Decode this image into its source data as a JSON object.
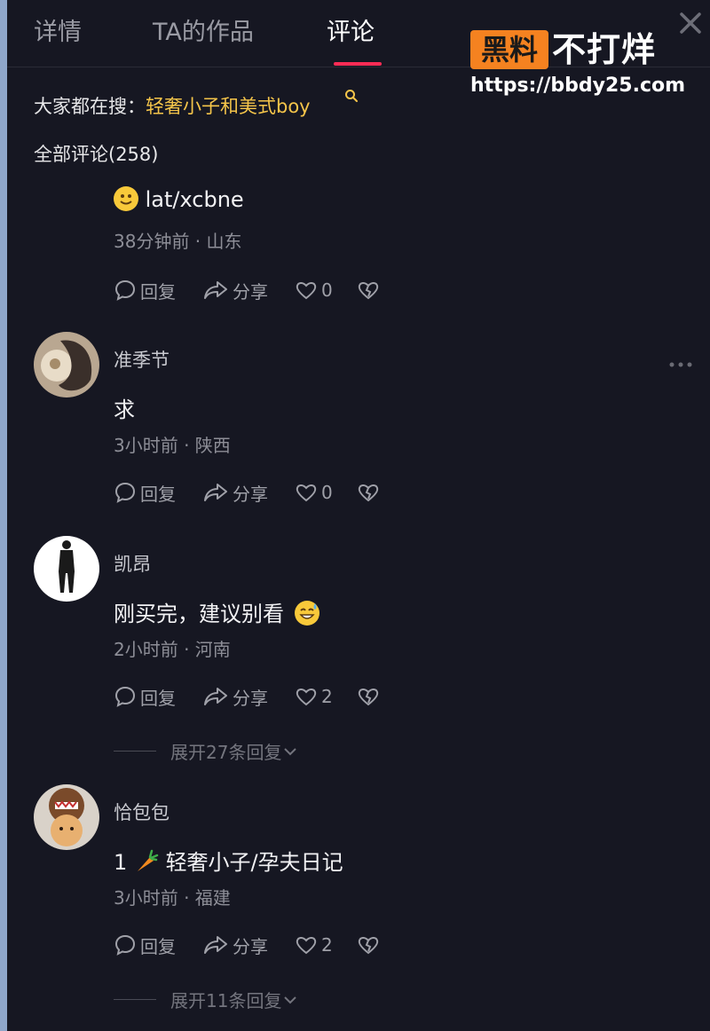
{
  "tabs": [
    {
      "label": "详情"
    },
    {
      "label": "TA的作品"
    },
    {
      "label": "评论"
    }
  ],
  "watermark": {
    "badge": "黑料",
    "text": "不打烊",
    "url": "https://bbdy25.com"
  },
  "search": {
    "label": "大家都在搜：",
    "term": "轻奢小子和美式boy"
  },
  "comments_header": "全部评论(258)",
  "action_labels": {
    "reply": "回复",
    "share": "分享"
  },
  "comments": [
    {
      "author": "",
      "content": "lat/xcbne",
      "meta": "38分钟前 · 山东",
      "likes": "0",
      "expand": ""
    },
    {
      "author": "准季节",
      "content": "求",
      "meta": "3小时前 · 陕西",
      "likes": "0",
      "expand": ""
    },
    {
      "author": "凯昂",
      "content": "刚买完，建议别看",
      "meta": "2小时前 · 河南",
      "likes": "2",
      "expand": "展开27条回复"
    },
    {
      "author": "恰包包",
      "content_prefix": "1",
      "content": "轻奢小子/孕夫日记",
      "meta": "3小时前 · 福建",
      "likes": "2",
      "expand": "展开11条回复"
    }
  ],
  "colors": {
    "accent": "#fe2c55",
    "search_term": "#f5c54a",
    "background": "#161722"
  }
}
